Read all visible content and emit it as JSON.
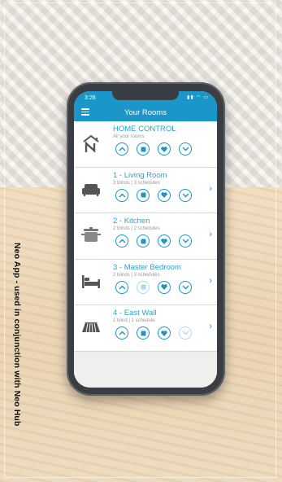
{
  "caption": "Neo App - used in conjunction with Neo Hub",
  "status_bar": {
    "time": "3:26"
  },
  "header": {
    "title": "Your Rooms"
  },
  "rooms": [
    {
      "title": "HOME CONTROL",
      "subtitle": "All your rooms",
      "icon": "home-icon",
      "chevron": false
    },
    {
      "title": "1 - Living Room",
      "subtitle": "3 blinds | 3 schedules",
      "icon": "sofa-icon",
      "chevron": true
    },
    {
      "title": "2 - Kitchen",
      "subtitle": "2 blinds | 2 schedules",
      "icon": "cooking-pot-icon",
      "chevron": true
    },
    {
      "title": "3 - Master Bedroom",
      "subtitle": "2 blinds | 3 schedules",
      "icon": "bed-icon",
      "chevron": true
    },
    {
      "title": "4 - East Wall",
      "subtitle": "1 blind | 1 schedule",
      "icon": "awning-icon",
      "chevron": true
    }
  ],
  "colors": {
    "accent": "#1a96c8",
    "title_text": "#2aa3cf",
    "subtitle_text": "#9a9a9a"
  }
}
